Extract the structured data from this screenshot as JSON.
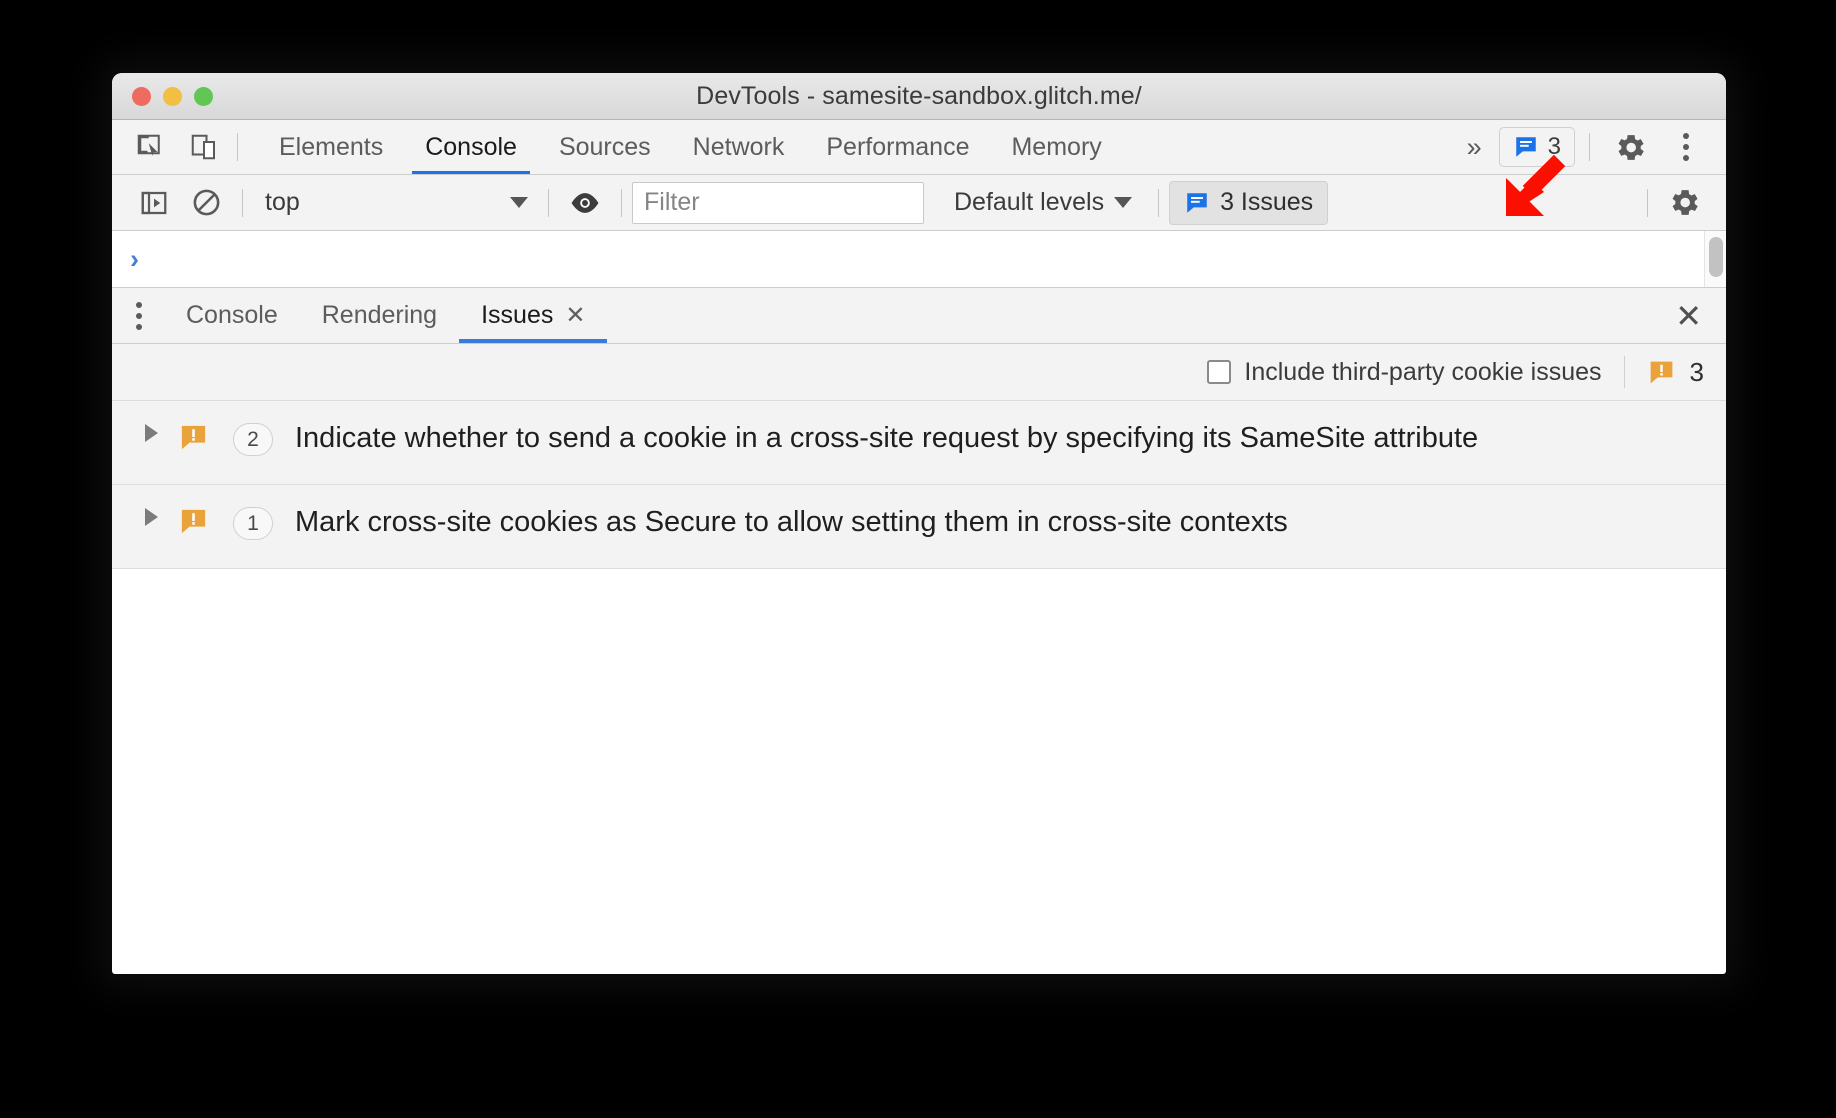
{
  "window": {
    "title": "DevTools - samesite-sandbox.glitch.me/",
    "traffic_lights": [
      "close",
      "minimize",
      "maximize"
    ]
  },
  "main_tabbar": {
    "icons": [
      {
        "name": "inspect-element-icon",
        "label": "Inspect element"
      },
      {
        "name": "device-toolbar-icon",
        "label": "Toggle device toolbar"
      }
    ],
    "tabs": [
      {
        "label": "Elements",
        "active": false
      },
      {
        "label": "Console",
        "active": true
      },
      {
        "label": "Sources",
        "active": false
      },
      {
        "label": "Network",
        "active": false
      },
      {
        "label": "Performance",
        "active": false
      },
      {
        "label": "Memory",
        "active": false
      }
    ],
    "more_tabs_label": "»",
    "issues_chip": {
      "count": "3",
      "icon": "issues-speech-bubble-icon"
    },
    "settings_label": "Settings",
    "menu_label": "Customize and control DevTools"
  },
  "console_toolbar": {
    "sidebar_toggle": "console-sidebar-icon",
    "clear_console": "clear-console-icon",
    "context_selector": {
      "value": "top"
    },
    "live_expression": "eye-icon",
    "filter": {
      "placeholder": "Filter",
      "value": ""
    },
    "levels": {
      "label": "Default levels"
    },
    "issues_button": {
      "label": "3 Issues",
      "active": true
    },
    "settings": "console-settings-gear-icon"
  },
  "console_output": {
    "prompt": "›",
    "entries": []
  },
  "drawer": {
    "menu_icon": "drawer-more-options-icon",
    "tabs": [
      {
        "label": "Console",
        "active": false,
        "closable": false
      },
      {
        "label": "Rendering",
        "active": false,
        "closable": false
      },
      {
        "label": "Issues",
        "active": true,
        "closable": true,
        "close_glyph": "✕"
      }
    ],
    "close_glyph": "✕"
  },
  "issues_panel": {
    "third_party_checkbox": {
      "label": "Include third-party cookie issues",
      "checked": false
    },
    "total_count": "3",
    "total_icon": "warning-speech-bubble-icon",
    "rows": [
      {
        "count": "2",
        "icon": "warning-speech-bubble-icon",
        "text": "Indicate whether to send a cookie in a cross-site request by specifying its SameSite attribute",
        "expanded": false
      },
      {
        "count": "1",
        "icon": "warning-speech-bubble-icon",
        "text": "Mark cross-site cookies as Secure to allow setting them in cross-site contexts",
        "expanded": false
      }
    ]
  },
  "annotation": {
    "arrow": {
      "name": "red-pointer-arrow",
      "direction": "down-left",
      "color": "#fa0f00"
    }
  },
  "colors": {
    "accent_blue": "#1a73e8",
    "warning_orange": "#e9a33a",
    "issue_blue": "#1a73e8",
    "annotation_red": "#fa0f00",
    "chrome_bg": "#f3f3f3"
  }
}
